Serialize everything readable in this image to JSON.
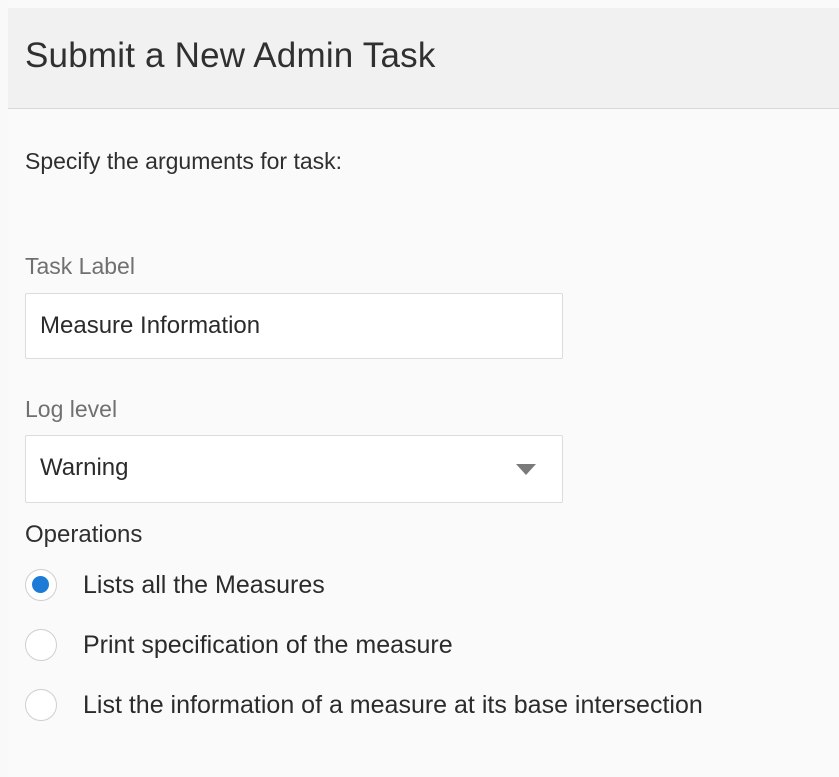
{
  "dialog": {
    "title": "Submit a New Admin Task",
    "intro": "Specify the arguments for task:"
  },
  "task_label": {
    "label": "Task Label",
    "value": "Measure Information"
  },
  "log_level": {
    "label": "Log level",
    "selected": "Warning"
  },
  "operations": {
    "label": "Operations",
    "options": [
      {
        "label": "Lists all the Measures",
        "checked": true
      },
      {
        "label": "Print specification of the measure",
        "checked": false
      },
      {
        "label": "List the information of a measure at its base intersection",
        "checked": false
      }
    ]
  },
  "colors": {
    "accent": "#1b7bd6",
    "header_bg": "#f1f1f1",
    "page_bg": "#fafafa"
  },
  "icons": {
    "select_arrow": "chevron-down-icon"
  }
}
